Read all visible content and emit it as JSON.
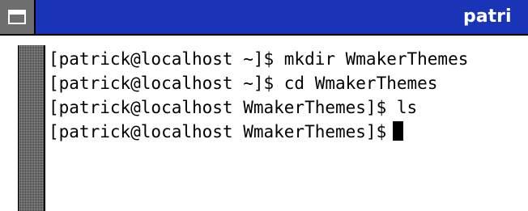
{
  "window": {
    "title": "patri"
  },
  "titlebar": {
    "menu_icon": "window-menu-icon",
    "color": "#1a34b8"
  },
  "terminal": {
    "lines": [
      "[patrick@localhost ~]$ mkdir WmakerThemes",
      "[patrick@localhost ~]$ cd WmakerThemes",
      "[patrick@localhost WmakerThemes]$ ls",
      "[patrick@localhost WmakerThemes]$"
    ]
  }
}
